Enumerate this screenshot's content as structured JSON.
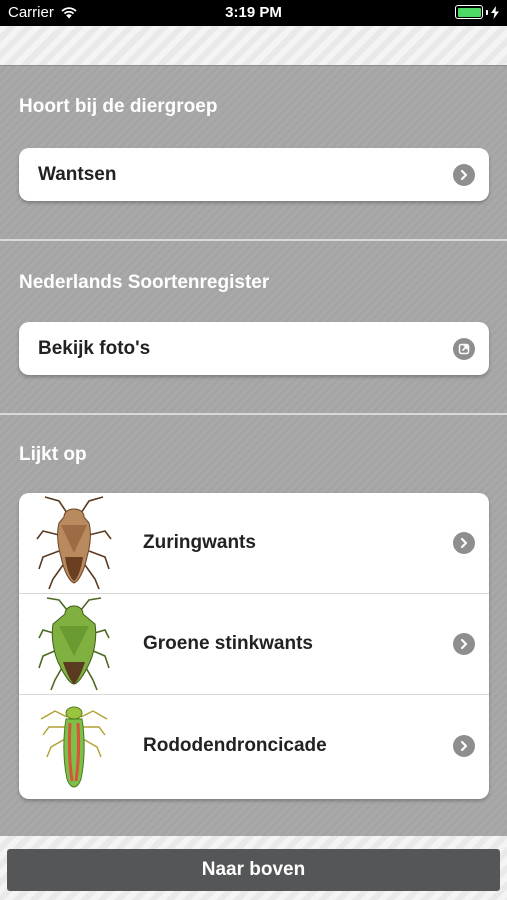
{
  "status_bar": {
    "carrier": "Carrier",
    "time": "3:19 PM"
  },
  "sections": {
    "group": {
      "title": "Hoort bij de diergroep",
      "item_label": "Wantsen",
      "item_icon": "chevron-right-icon"
    },
    "register": {
      "title": "Nederlands Soortenregister",
      "item_label": "Bekijk foto's",
      "item_icon": "external-link-icon"
    },
    "similar": {
      "title": "Lijkt op",
      "items": [
        {
          "label": "Zuringwants",
          "image": "brown-shield-bug-illustration"
        },
        {
          "label": "Groene stinkwants",
          "image": "green-stink-bug-illustration"
        },
        {
          "label": "Rododendroncicade",
          "image": "rhododendron-leafhopper-illustration"
        }
      ]
    }
  },
  "footer": {
    "button_label": "Naar boven"
  },
  "colors": {
    "background": "#a7a7a7",
    "card": "#ffffff",
    "button": "#555657",
    "chevron": "#8e8e8e",
    "battery": "#4cd964"
  }
}
